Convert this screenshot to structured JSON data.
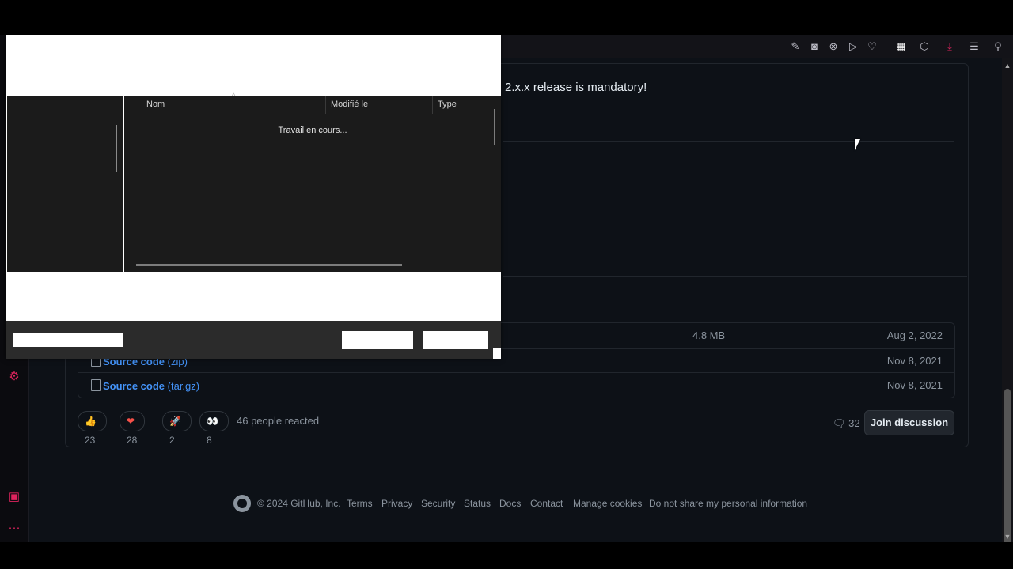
{
  "page": {
    "release_note_partial": "2.x.x release is mandatory!"
  },
  "assets": [
    {
      "name": "",
      "size": "4.8 MB",
      "date": "Aug 2, 2022"
    },
    {
      "name_bold": "Source code",
      "name_suffix": " (zip)",
      "size": "",
      "date": "Nov 8, 2021"
    },
    {
      "name_bold": "Source code",
      "name_suffix": " (tar.gz)",
      "size": "",
      "date": "Nov 8, 2021"
    }
  ],
  "reactions": {
    "items": [
      {
        "emoji": "👍",
        "count": "23"
      },
      {
        "emoji": "❤",
        "count": "28"
      },
      {
        "emoji": "🚀",
        "count": "2"
      },
      {
        "emoji": "👀",
        "count": "8"
      }
    ],
    "summary": "46 people reacted"
  },
  "discussion": {
    "comment_count": "32",
    "join_label": "Join discussion"
  },
  "footer": {
    "copyright": "© 2024 GitHub, Inc.",
    "links": [
      "Terms",
      "Privacy",
      "Security",
      "Status",
      "Docs",
      "Contact",
      "Manage cookies",
      "Do not share my personal information"
    ]
  },
  "dialog": {
    "columns": {
      "name": "Nom",
      "modified": "Modifié le",
      "type": "Type"
    },
    "status": "Travail en cours..."
  },
  "icons": {
    "toolbar": [
      "edit-icon",
      "camera-icon",
      "close-circle-icon",
      "send-icon",
      "heart-icon",
      "qr-icon",
      "cube-icon",
      "download-icon",
      "menu-icon",
      "user-icon"
    ],
    "rail": [
      "settings-icon",
      "gallery-icon",
      "more-icon"
    ]
  },
  "colors": {
    "accent": "#e0245e",
    "link": "#4493f8",
    "background": "#0d1117"
  }
}
